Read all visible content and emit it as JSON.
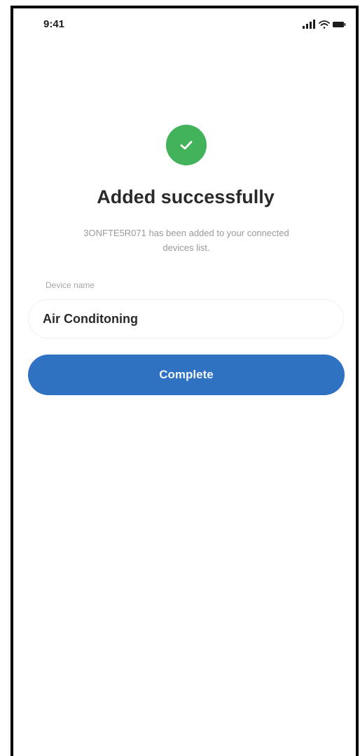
{
  "status_bar": {
    "time": "9:41",
    "icons": [
      "signal-icon",
      "wifi-icon",
      "battery-icon"
    ]
  },
  "result": {
    "icon": "checkmark-icon",
    "icon_color": "#42b35a",
    "title": "Added successfully",
    "message": "3ONFTE5R071 has been added to your connected devices list."
  },
  "device_name": {
    "label": "Device name",
    "value": "Air Conditoning"
  },
  "actions": {
    "complete_label": "Complete",
    "complete_color": "#2f72c2"
  }
}
